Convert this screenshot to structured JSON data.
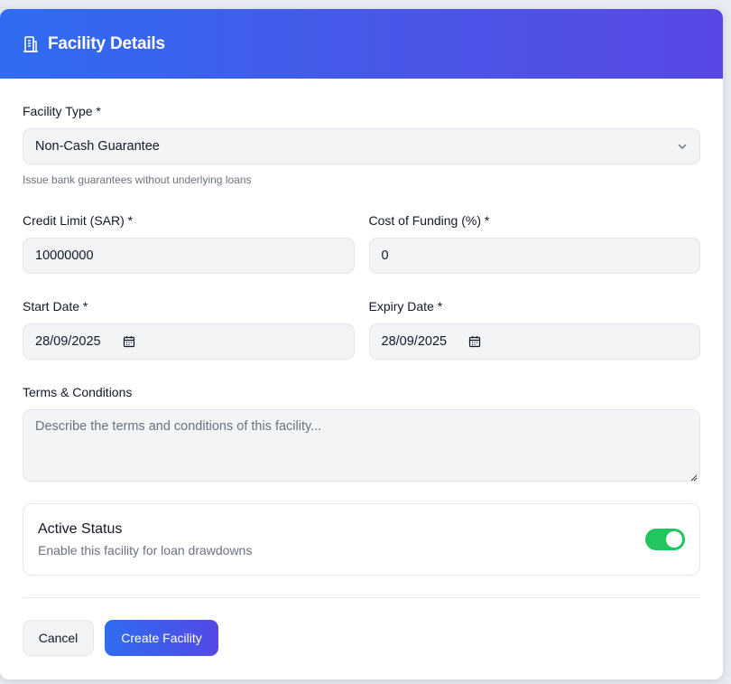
{
  "header": {
    "title": "Facility Details",
    "icon": "building-icon"
  },
  "facility_type": {
    "label": "Facility Type *",
    "value": "Non-Cash Guarantee",
    "hint": "Issue bank guarantees without underlying loans"
  },
  "credit_limit": {
    "label": "Credit Limit (SAR) *",
    "value": "10000000"
  },
  "cost_of_funding": {
    "label": "Cost of Funding (%) *",
    "value": "0"
  },
  "start_date": {
    "label": "Start Date *",
    "value": "28/09/2025"
  },
  "expiry_date": {
    "label": "Expiry Date *",
    "value": "28/09/2025"
  },
  "terms": {
    "label": "Terms & Conditions",
    "placeholder": "Describe the terms and conditions of this facility..."
  },
  "active_status": {
    "title": "Active Status",
    "description": "Enable this facility for loan drawdowns",
    "enabled": true
  },
  "actions": {
    "cancel_label": "Cancel",
    "create_label": "Create Facility"
  },
  "colors": {
    "accent_start": "#2f6cf0",
    "accent_end": "#5848e5",
    "toggle_on": "#22c55e"
  }
}
